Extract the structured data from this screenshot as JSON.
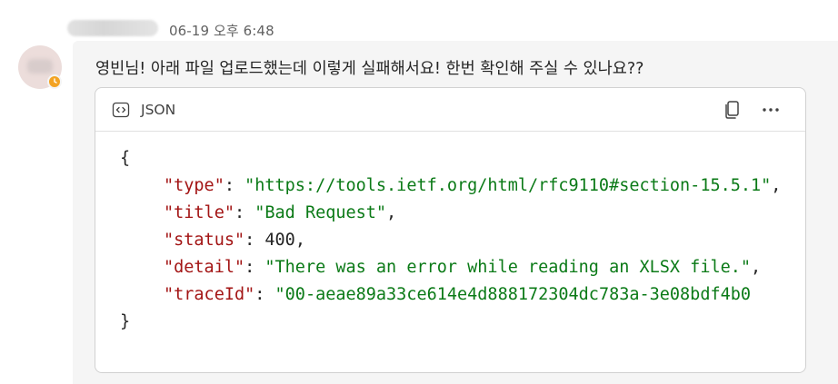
{
  "message": {
    "timestamp": "06-19 오후 6:48",
    "text": "영빈님! 아래 파일 업로드했는데 이렇게 실패해서요! 한번 확인해 주실 수 있나요??",
    "status_color": "#f3a323"
  },
  "code_block": {
    "language": "JSON",
    "open_brace": "{",
    "close_brace": "}",
    "lines": [
      {
        "key": "\"type\"",
        "sep": ": ",
        "value": "\"https://tools.ietf.org/html/rfc9110#section-15.5.1\"",
        "value_kind": "string",
        "tail": ","
      },
      {
        "key": "\"title\"",
        "sep": ": ",
        "value": "\"Bad Request\"",
        "value_kind": "string",
        "tail": ","
      },
      {
        "key": "\"status\"",
        "sep": ": ",
        "value": "400",
        "value_kind": "number",
        "tail": ","
      },
      {
        "key": "\"detail\"",
        "sep": ": ",
        "value": "\"There was an error while reading an XLSX file.\"",
        "value_kind": "string",
        "tail": ","
      },
      {
        "key": "\"traceId\"",
        "sep": ": ",
        "value": "\"00-aeae89a33ce614e4d888172304dc783a-3e08bdf4b0",
        "value_kind": "string",
        "tail": ""
      }
    ]
  },
  "icons": {
    "language": "code-brackets-icon",
    "copy": "copy-icon",
    "more": "more-horizontal-icon",
    "status": "clock-icon"
  },
  "colors": {
    "bubble_bg": "#f5f5f5",
    "json_key": "#a31515",
    "json_string": "#0b7a17",
    "text": "#242424"
  }
}
